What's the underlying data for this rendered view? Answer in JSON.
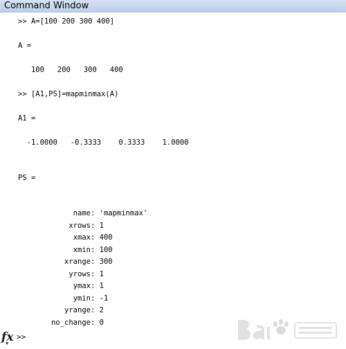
{
  "window": {
    "title": "Command Window"
  },
  "console": {
    "lines": [
      ">> A=[100 200 300 400]",
      "A =",
      "   100   200   300   400",
      ">> [A1,PS]=mapminmax(A)",
      "A1 =",
      "  -1.0000   -0.3333    0.3333    1.0000",
      "PS ="
    ],
    "fields": [
      {
        "name": "name:",
        "value": "'mapminmax'"
      },
      {
        "name": "xrows:",
        "value": "1"
      },
      {
        "name": "xmax:",
        "value": "400"
      },
      {
        "name": "xmin:",
        "value": "100"
      },
      {
        "name": "xrange:",
        "value": "300"
      },
      {
        "name": "yrows:",
        "value": "1"
      },
      {
        "name": "ymax:",
        "value": "1"
      },
      {
        "name": "ymin:",
        "value": "-1"
      },
      {
        "name": "yrange:",
        "value": "2"
      },
      {
        "name": "no_change:",
        "value": "0"
      }
    ]
  },
  "command_line": {
    "prompt": ">>",
    "fx_label": "fx",
    "fx_arrow": "▼"
  }
}
